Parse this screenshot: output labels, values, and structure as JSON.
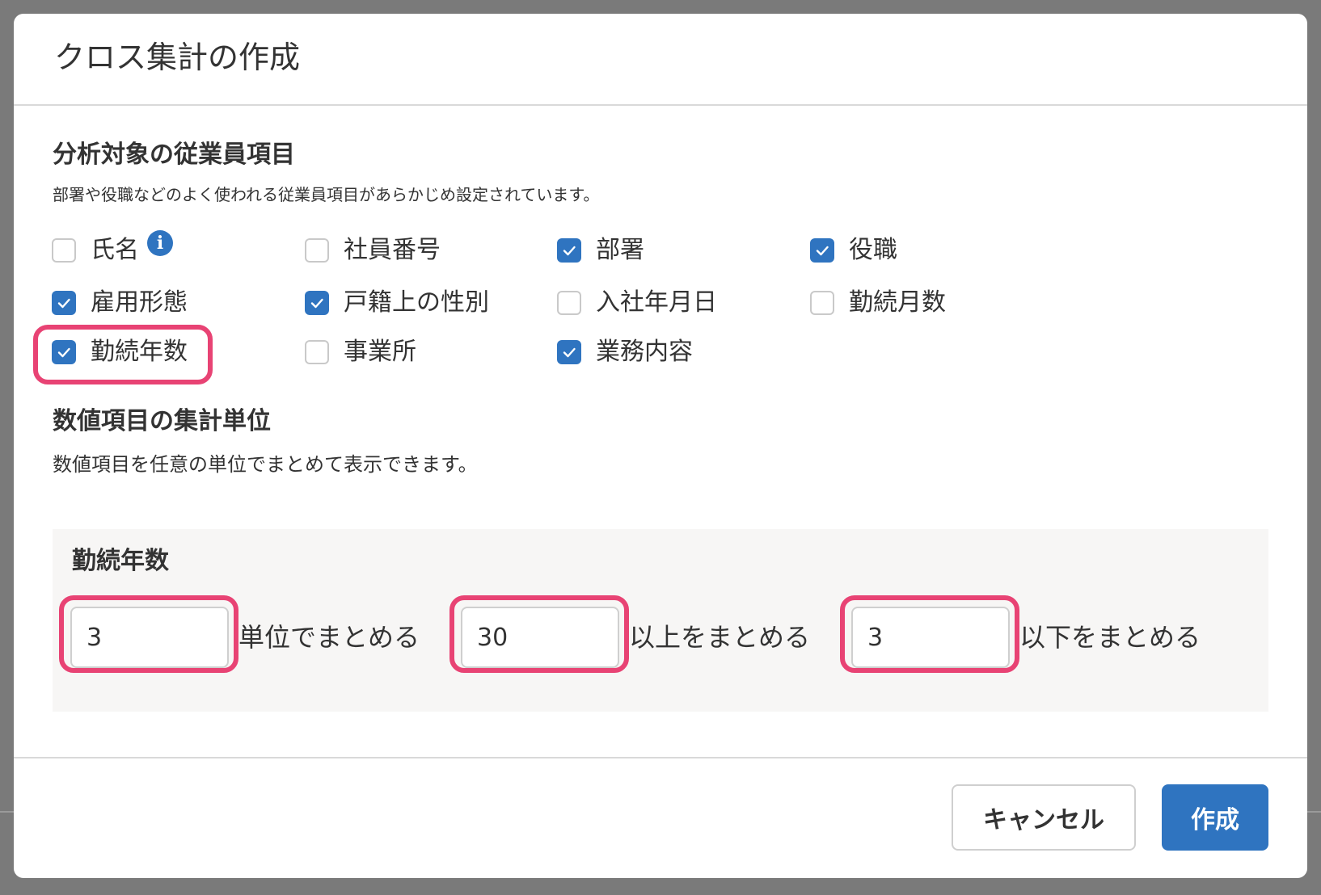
{
  "dialog": {
    "title": "クロス集計の作成"
  },
  "employee_fields": {
    "title": "分析対象の従業員項目",
    "description": "部署や役職などのよく使われる従業員項目があらかじめ設定されています。",
    "items": [
      {
        "label": "氏名",
        "checked": false,
        "info_icon": "info-icon"
      },
      {
        "label": "社員番号",
        "checked": false
      },
      {
        "label": "部署",
        "checked": true
      },
      {
        "label": "役職",
        "checked": true
      },
      {
        "label": "雇用形態",
        "checked": true
      },
      {
        "label": "戸籍上の性別",
        "checked": true
      },
      {
        "label": "入社年月日",
        "checked": false
      },
      {
        "label": "勤続月数",
        "checked": false
      },
      {
        "label": "勤続年数",
        "checked": true
      },
      {
        "label": "事業所",
        "checked": false
      },
      {
        "label": "業務内容",
        "checked": true
      }
    ]
  },
  "numeric_grouping": {
    "title": "数値項目の集計単位",
    "description": "数値項目を任意の単位でまとめて表示できます。",
    "panel": {
      "title": "勤続年数",
      "unit": {
        "value": "3",
        "suffix": "単位でまとめる"
      },
      "above": {
        "value": "30",
        "suffix": "以上をまとめる"
      },
      "below": {
        "value": "3",
        "suffix": "以下をまとめる"
      }
    }
  },
  "footer": {
    "cancel_label": "キャンセル",
    "create_label": "作成"
  },
  "colors": {
    "accent": "#2f74c0",
    "highlight": "#e84374"
  }
}
